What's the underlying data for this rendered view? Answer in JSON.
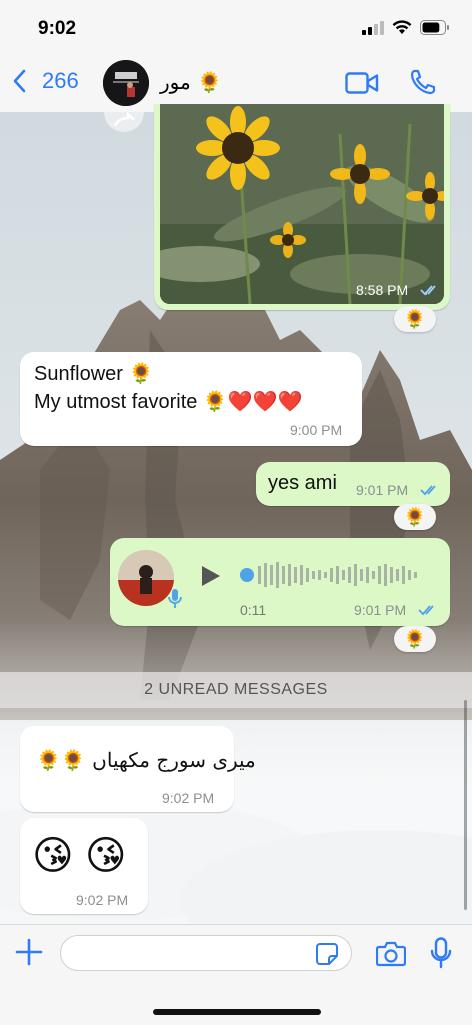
{
  "status_bar": {
    "time": "9:02",
    "battery_level": 0.8
  },
  "header": {
    "back_count": "266",
    "contact_name": "مور 🌻",
    "icons": [
      "chevron-left-icon",
      "video-camera-icon",
      "phone-icon"
    ]
  },
  "messages": {
    "photo": {
      "time": "8:58 PM",
      "reaction": "🌻"
    },
    "sunflower_text": {
      "line1": "Sunflower 🌻",
      "line2": "My utmost favorite 🌻❤️❤️❤️",
      "time": "9:00 PM"
    },
    "yes_ami": {
      "text": "yes ami",
      "time": "9:01 PM",
      "reaction": "🌻"
    },
    "voice_note": {
      "duration": "0:11",
      "time": "9:01 PM",
      "reaction": "🌻"
    },
    "urdu_text": {
      "text": "میری سورج مکھیاں 🌻🌻",
      "time": "9:02 PM"
    },
    "kiss_emoji": {
      "text": "😘 😘",
      "time": "9:02 PM"
    }
  },
  "unread_banner": "2 UNREAD MESSAGES",
  "composer": {
    "placeholder": ""
  },
  "colors": {
    "accent": "#2f7bf5",
    "outgoing_bubble": "#dcf8c6",
    "incoming_bubble": "#ffffff",
    "read_ticks": "#4fa3e8"
  }
}
